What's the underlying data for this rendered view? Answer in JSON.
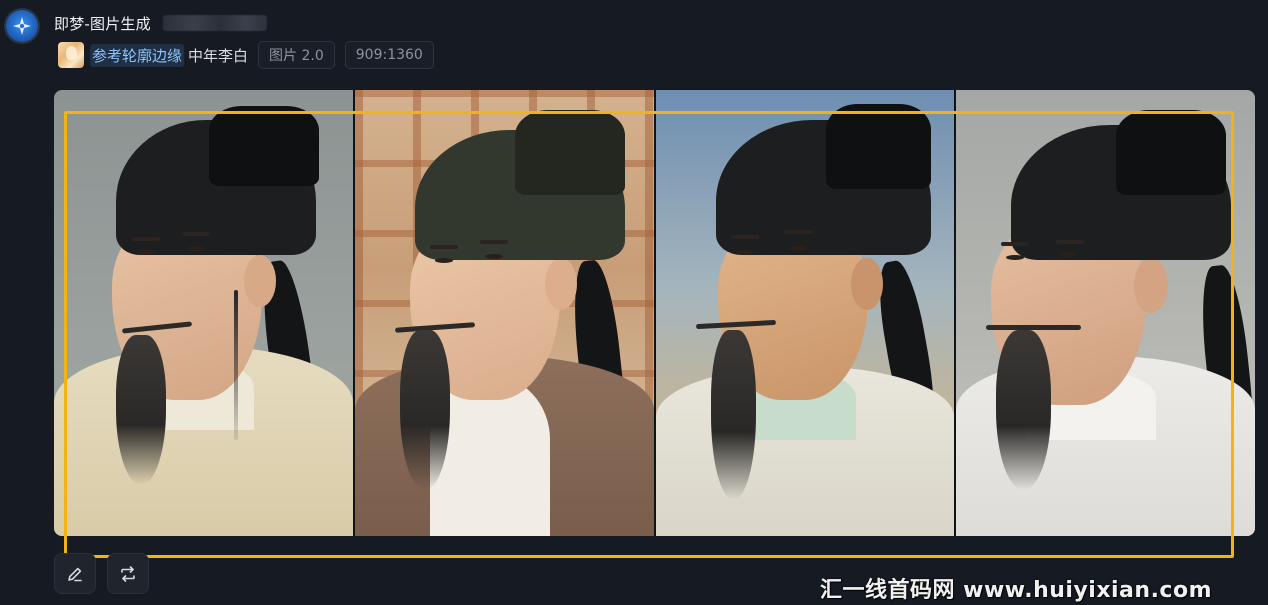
{
  "header": {
    "app_title": "即梦-图片生成",
    "avatar_icon": "jimeng-star-icon"
  },
  "prompt": {
    "reference_label": "参考轮廓边缘",
    "text": "中年李白",
    "model_tag": "图片 2.0",
    "ratio_tag": "909:1360"
  },
  "gallery": {
    "images": [
      {
        "name": "generated-image-1"
      },
      {
        "name": "generated-image-2"
      },
      {
        "name": "generated-image-3"
      },
      {
        "name": "generated-image-4"
      }
    ]
  },
  "actions": {
    "edit_icon": "pencil-icon",
    "regenerate_icon": "repeat-icon"
  },
  "colors": {
    "background": "#161a22",
    "highlight_box": "#f0b413",
    "link": "#8fc4ff"
  },
  "watermark": {
    "text": "汇一线首码网 www.huiyixian.com"
  }
}
